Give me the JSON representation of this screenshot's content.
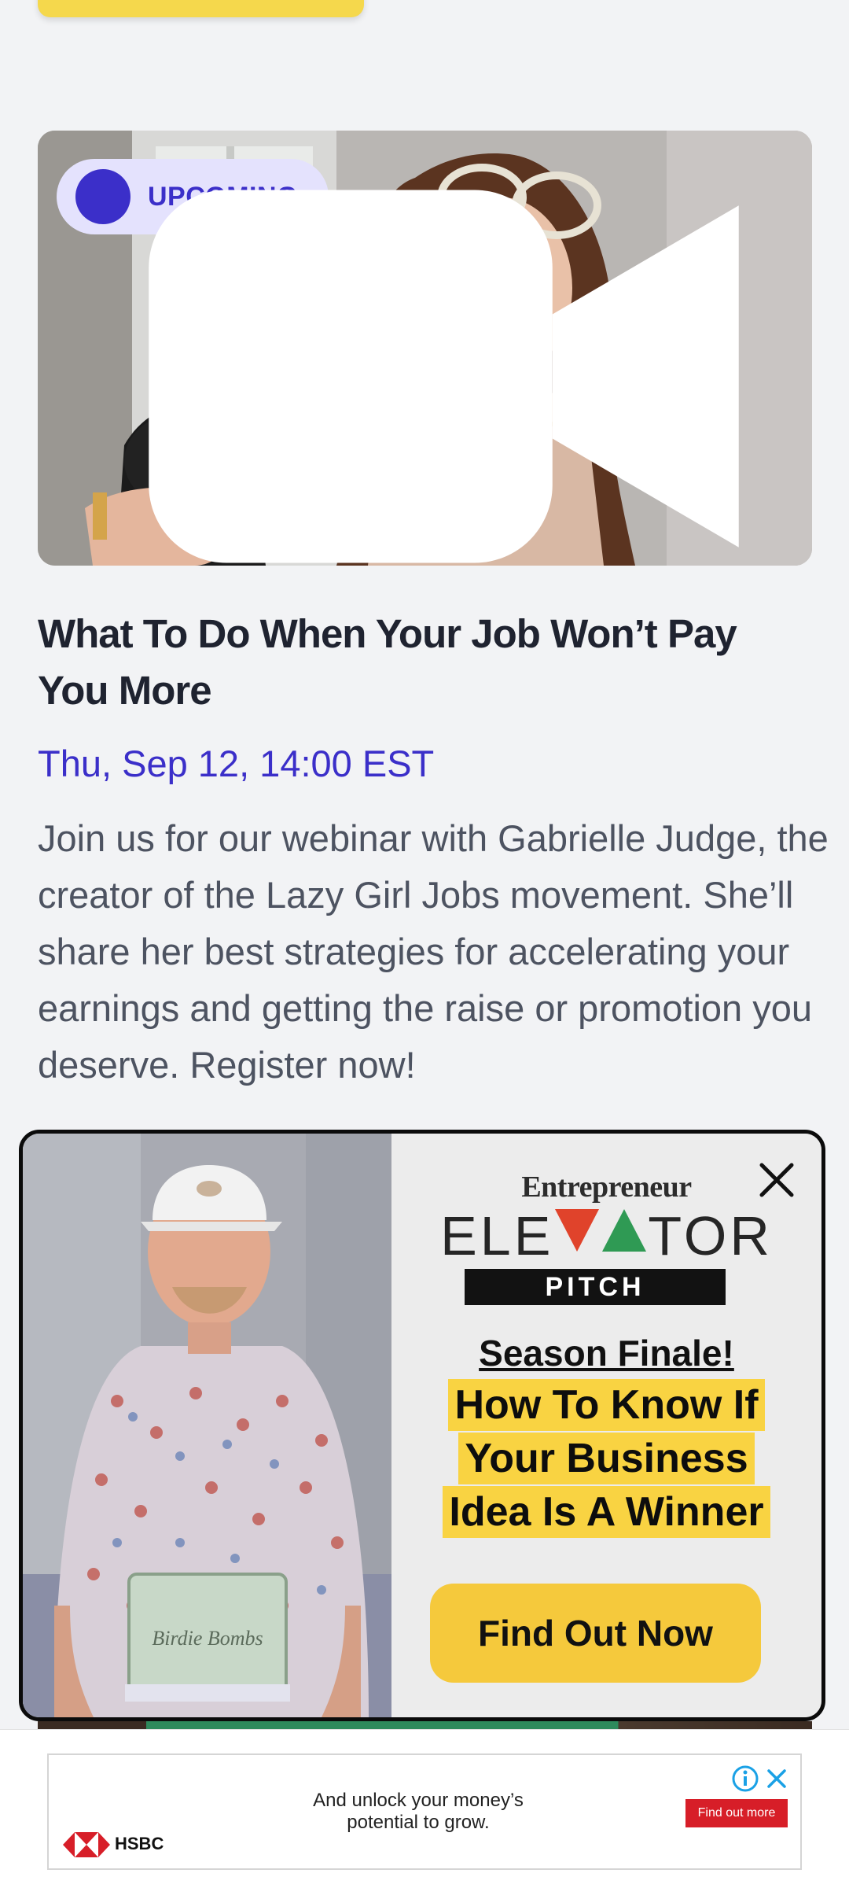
{
  "event": {
    "badge": "UPCOMING",
    "title": "What To Do When Your Job Won’t Pay You More",
    "date": "Thu, Sep 12, 14:00 EST",
    "description": "Join us for our webinar with Gabrielle Judge, the creator of the Lazy Girl Jobs movement. She’ll share her best strategies for accelerating your earnings and getting the raise or promotion you deserve. Register now!"
  },
  "popup_ad": {
    "brand": "Entrepreneur",
    "show_left": "ELE",
    "show_right": "TOR",
    "show_sub": "PITCH",
    "kicker": "Season Finale!",
    "headline_lines": [
      "How To Know If",
      "Your Business",
      "Idea Is A Winner"
    ],
    "cta": "Find Out Now",
    "product_label": "Birdie Bombs"
  },
  "banner_ad": {
    "text": "And unlock your money’s potential to grow.",
    "brand": "HSBC",
    "cta": "Find out more"
  },
  "colors": {
    "accent": "#3b2fc9",
    "badge_bg": "#e4e2fd",
    "highlight": "#f9d342",
    "cta_yellow": "#f5c93c",
    "hsbc_red": "#d71e28"
  }
}
